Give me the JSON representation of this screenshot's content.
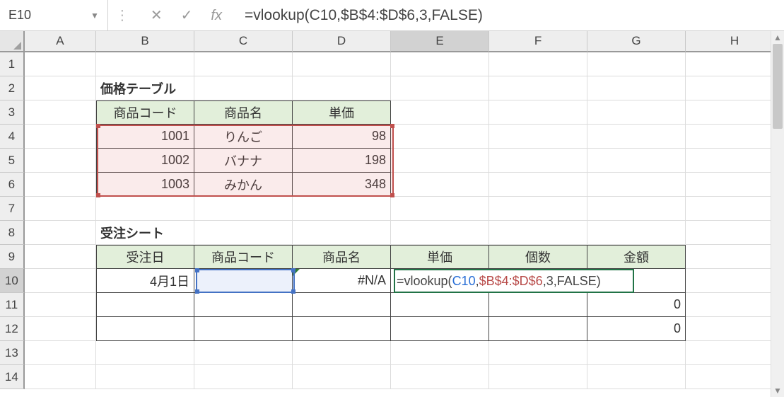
{
  "namebox": "E10",
  "formula_plain": "=vlookup(C10,$B$4:$D$6,3,FALSE)",
  "formula_parts": {
    "p1": "=vlookup(",
    "ref1": "C10",
    "c1": ",",
    "ref2": "$B$4:$D$6",
    "c2": ",",
    "a3": "3",
    "c3": ",",
    "a4": "FALSE",
    "p2": ")"
  },
  "cols": [
    "A",
    "B",
    "C",
    "D",
    "E",
    "F",
    "G",
    "H"
  ],
  "rows": [
    "1",
    "2",
    "3",
    "4",
    "5",
    "6",
    "7",
    "8",
    "9",
    "10",
    "11",
    "12",
    "13",
    "14"
  ],
  "priceTable": {
    "title": "価格テーブル",
    "hdr": {
      "code": "商品コード",
      "name": "商品名",
      "price": "単価"
    },
    "data": [
      {
        "code": "1001",
        "name": "りんご",
        "price": "98"
      },
      {
        "code": "1002",
        "name": "バナナ",
        "price": "198"
      },
      {
        "code": "1003",
        "name": "みかん",
        "price": "348"
      }
    ]
  },
  "orderSheet": {
    "title": "受注シート",
    "hdr": {
      "date": "受注日",
      "code": "商品コード",
      "name": "商品名",
      "price": "単価",
      "qty": "個数",
      "amount": "金額"
    },
    "rows": [
      {
        "date": "4月1日",
        "code": "",
        "name": "#N/A",
        "price": "",
        "qty": "",
        "amount": ""
      },
      {
        "date": "",
        "code": "",
        "name": "",
        "price": "",
        "qty": "",
        "amount": "0"
      },
      {
        "date": "",
        "code": "",
        "name": "",
        "price": "",
        "qty": "",
        "amount": "0"
      }
    ]
  },
  "activeCol": "E",
  "activeRow": "10"
}
